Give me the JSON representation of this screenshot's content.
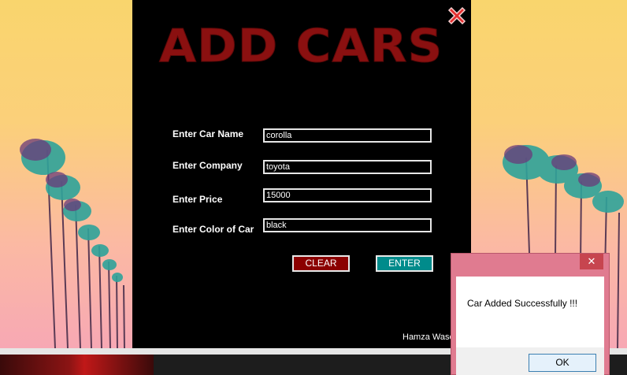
{
  "form": {
    "title": "ADD CARS",
    "fields": [
      {
        "label": "Enter Car Name",
        "value": "corolla"
      },
      {
        "label": "Enter Company",
        "value": "toyota"
      },
      {
        "label": "Enter Price",
        "value": "15000"
      },
      {
        "label": "Enter Color of Car",
        "value": "black"
      }
    ],
    "clear_label": "CLEAR",
    "enter_label": "ENTER",
    "author": "Hamza Wase"
  },
  "dialog": {
    "message": "Car Added Successfully !!!",
    "ok_label": "OK",
    "close_glyph": "✕"
  },
  "icons": {
    "close": "close-x-icon"
  },
  "colors": {
    "title": "#8a1010",
    "clear_button": "#8b0000",
    "enter_button": "#008b8b",
    "dialog_frame": "#e07b90"
  }
}
